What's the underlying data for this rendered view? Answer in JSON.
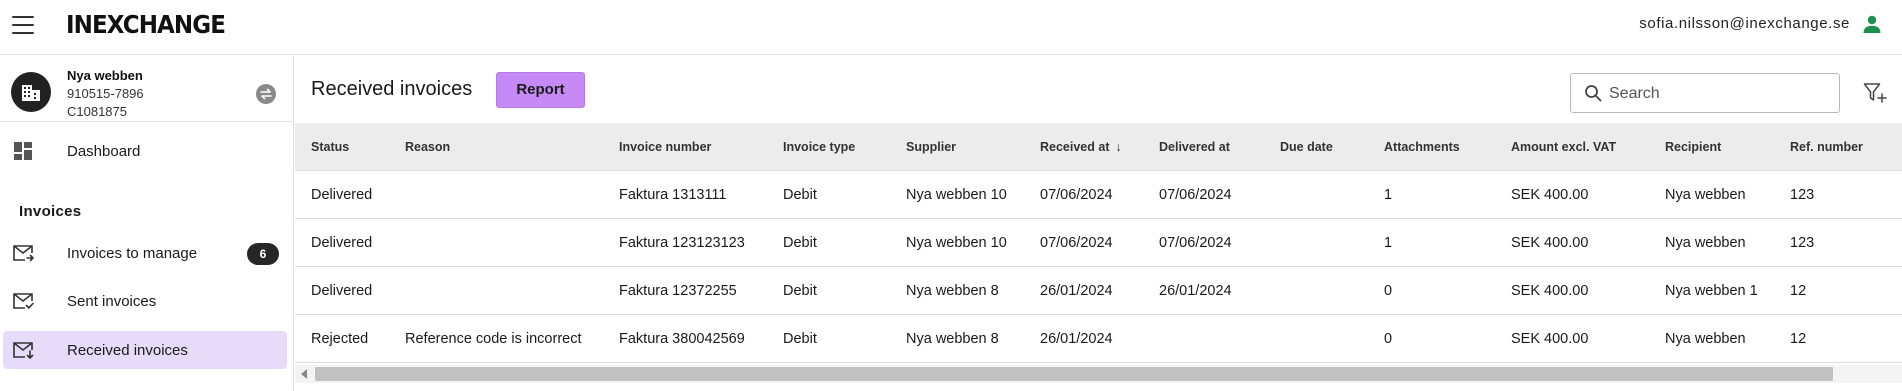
{
  "header": {
    "logo": "INEXCHANGE",
    "user_email": "sofia.nilsson@inexchange.se",
    "user_icon_color": "#1f8f4e"
  },
  "sidebar": {
    "org": {
      "name": "Nya webben",
      "org_number": "910515-7896",
      "customer_id": "C1081875"
    },
    "dashboard_label": "Dashboard",
    "section_title": "Invoices",
    "items": [
      {
        "label": "Invoices to manage",
        "icon": "mail-arrow-icon",
        "badge": "6",
        "active": false
      },
      {
        "label": "Sent invoices",
        "icon": "mail-check-icon",
        "active": false
      },
      {
        "label": "Received invoices",
        "icon": "mail-download-icon",
        "active": true
      }
    ]
  },
  "main": {
    "title": "Received invoices",
    "report_label": "Report",
    "search_placeholder": "Search",
    "accent_color": "#c58af5"
  },
  "table": {
    "columns": [
      "Status",
      "Reason",
      "Invoice number",
      "Invoice type",
      "Supplier",
      "Received at",
      "Delivered at",
      "Due date",
      "Attachments",
      "Amount excl. VAT",
      "Recipient",
      "Ref. number"
    ],
    "sort_indicator": "↓",
    "rows": [
      {
        "status": "Delivered",
        "reason": "",
        "invoice_number": "Faktura 1313111",
        "invoice_type": "Debit",
        "supplier": "Nya webben 10",
        "received_at": "07/06/2024",
        "delivered_at": "07/06/2024",
        "due_date": "",
        "attachments": "1",
        "amount": "SEK 400.00",
        "recipient": "Nya webben",
        "ref_number": "123"
      },
      {
        "status": "Delivered",
        "reason": "",
        "invoice_number": "Faktura 123123123",
        "invoice_type": "Debit",
        "supplier": "Nya webben 10",
        "received_at": "07/06/2024",
        "delivered_at": "07/06/2024",
        "due_date": "",
        "attachments": "1",
        "amount": "SEK 400.00",
        "recipient": "Nya webben",
        "ref_number": "123"
      },
      {
        "status": "Delivered",
        "reason": "",
        "invoice_number": "Faktura 12372255",
        "invoice_type": "Debit",
        "supplier": "Nya webben 8",
        "received_at": "26/01/2024",
        "delivered_at": "26/01/2024",
        "due_date": "",
        "attachments": "0",
        "amount": "SEK 400.00",
        "recipient": "Nya webben 1",
        "ref_number": "12"
      },
      {
        "status": "Rejected",
        "reason": "Reference code is incorrect",
        "invoice_number": "Faktura 380042569",
        "invoice_type": "Debit",
        "supplier": "Nya webben 8",
        "received_at": "26/01/2024",
        "delivered_at": "",
        "due_date": "",
        "attachments": "0",
        "amount": "SEK 400.00",
        "recipient": "Nya webben",
        "ref_number": "12"
      }
    ]
  }
}
